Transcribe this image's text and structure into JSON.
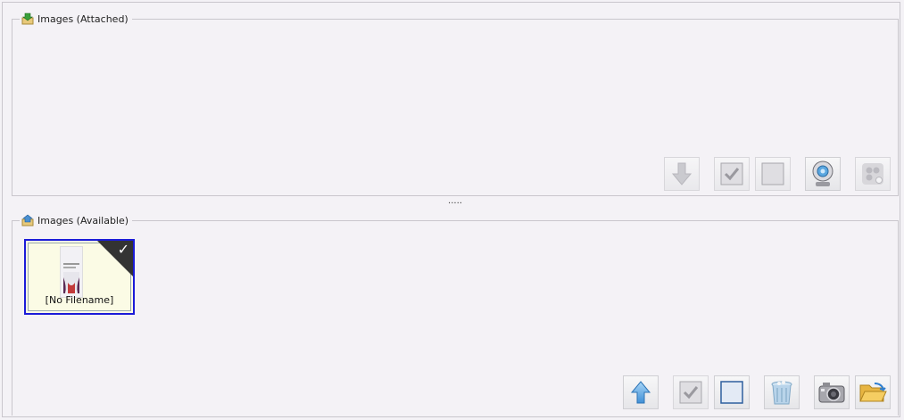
{
  "attached": {
    "title": "Images (Attached)",
    "buttons": [
      {
        "name": "move-down-button",
        "icon": "arrow-down-icon"
      },
      {
        "name": "select-all-button",
        "icon": "checkbox-checked-icon"
      },
      {
        "name": "deselect-all-button",
        "icon": "checkbox-empty-icon"
      },
      {
        "name": "webcam-button",
        "icon": "webcam-icon"
      },
      {
        "name": "scanner-button",
        "icon": "scanner-icon"
      }
    ]
  },
  "splitter": {
    "label": "....."
  },
  "available": {
    "title": "Images (Available)",
    "items": [
      {
        "label": "[No Filename]",
        "selected": true
      }
    ],
    "buttons": [
      {
        "name": "move-up-button",
        "icon": "arrow-up-icon"
      },
      {
        "name": "select-all-button",
        "icon": "checkbox-checked-icon"
      },
      {
        "name": "deselect-all-button",
        "icon": "checkbox-empty-icon"
      },
      {
        "name": "delete-button",
        "icon": "trash-icon"
      },
      {
        "name": "camera-button",
        "icon": "camera-icon"
      },
      {
        "name": "open-folder-button",
        "icon": "folder-open-icon"
      }
    ]
  },
  "colors": {
    "accent": "#1b1bd8",
    "background": "#f4f2f6",
    "border": "#c9c6cc"
  }
}
